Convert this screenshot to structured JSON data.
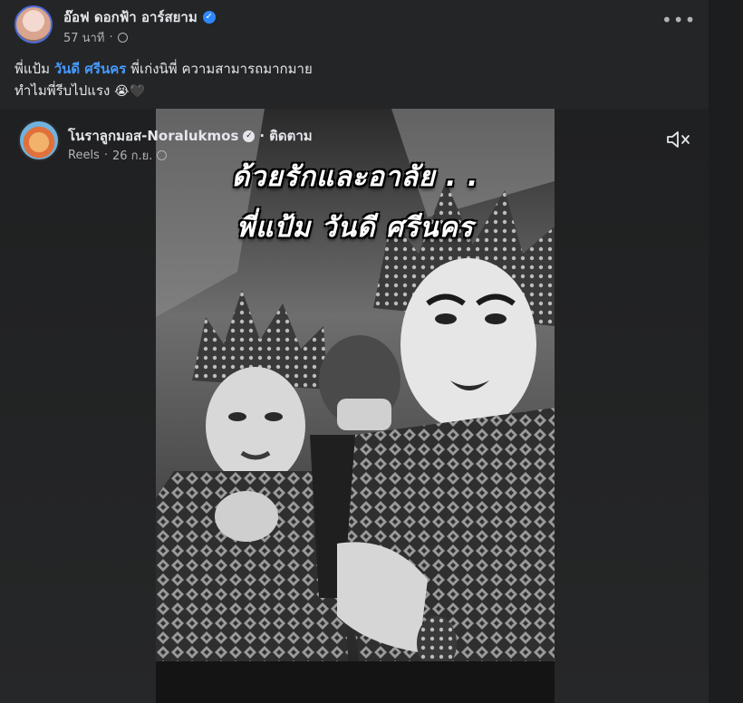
{
  "post": {
    "author": "อ๊อฟ ดอกฟ้า อาร์สยาม",
    "time": "57 นาที",
    "separator": "·",
    "more_label": "•••",
    "caption": {
      "prefix": "พี่แป้ม",
      "mention": "วันดี ศรีนคร",
      "suffix": "พี่เก่งนิพี่ ความสามารถมากมาย",
      "line2": "ทำไมพี่รีบไปแรง",
      "emojis": "😭🖤"
    }
  },
  "reel": {
    "author": "โนราลูกมอส-Noralukmos",
    "separator": "·",
    "follow_label": "ติดตาม",
    "type": "Reels",
    "date": "26 ก.ย.",
    "overlay_line1": "ด้วยรักและอาลัย . .",
    "overlay_line2": "พี่แป้ม วันดี ศรีนคร"
  },
  "colors": {
    "background": "#242526",
    "accent_link": "#4599ff",
    "verified": "#2d88ff"
  },
  "icons": {
    "verified": "verified-badge-icon",
    "globe": "globe-icon",
    "more": "more-horizontal-icon",
    "mute": "speaker-muted-icon"
  }
}
